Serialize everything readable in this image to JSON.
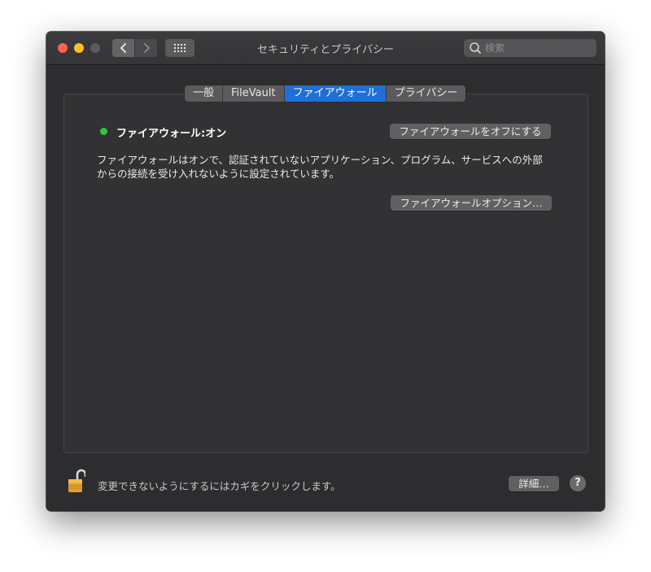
{
  "window": {
    "title": "セキュリティとプライバシー"
  },
  "search": {
    "placeholder": "検索"
  },
  "tabs": [
    {
      "label": "一般",
      "active": false
    },
    {
      "label": "FileVault",
      "active": false
    },
    {
      "label": "ファイアウォール",
      "active": true
    },
    {
      "label": "プライバシー",
      "active": false
    }
  ],
  "firewall": {
    "status_label": "ファイアウォール:オン",
    "turn_off_label": "ファイアウォールをオフにする",
    "description": "ファイアウォールはオンで、認証されていないアプリケーション、プログラム、サービスへの外部からの接続を受け入れないように設定されています。",
    "options_label": "ファイアウォールオプション…"
  },
  "footer": {
    "lock_text": "変更できないようにするにはカギをクリックします。",
    "details_label": "詳細…",
    "help_label": "?"
  },
  "icons": {
    "back": "chevron-left-icon",
    "forward": "chevron-right-icon",
    "grid": "grid-icon",
    "search": "search-icon",
    "lock": "lock-open-icon"
  },
  "colors": {
    "accent": "#1e6fd8",
    "status_on": "#2ec640",
    "close": "#fe5f57",
    "minimize": "#febc2e"
  }
}
